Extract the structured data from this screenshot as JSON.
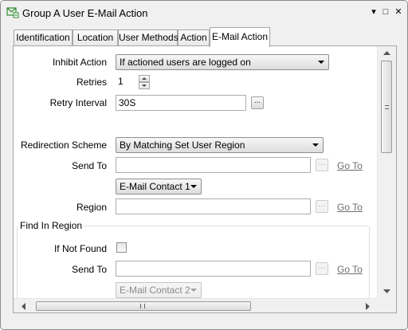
{
  "window": {
    "title": "Group A User E-Mail Action",
    "controls": [
      "▾",
      "□",
      "✕"
    ]
  },
  "tabs": [
    {
      "label": "Identification",
      "active": false
    },
    {
      "label": "Location",
      "active": false
    },
    {
      "label": "User Methods",
      "active": false
    },
    {
      "label": "Action",
      "active": false
    },
    {
      "label": "E-Mail Action",
      "active": true
    }
  ],
  "form": {
    "inhibit_action": {
      "label": "Inhibit Action",
      "value": "If actioned users are logged on"
    },
    "retries": {
      "label": "Retries",
      "value": "1"
    },
    "retry_interval": {
      "label": "Retry Interval",
      "value": "30S",
      "button": "..."
    },
    "redirection_scheme": {
      "label": "Redirection Scheme",
      "value": "By Matching Set User Region"
    },
    "send_to": {
      "label": "Send To",
      "value": "",
      "button": "...",
      "link": "Go To"
    },
    "contact": {
      "value": "E-Mail Contact 1"
    },
    "region": {
      "label": "Region",
      "value": "",
      "button": "...",
      "link": "Go To"
    }
  },
  "find_in_region": {
    "title": "Find In Region",
    "if_not_found": {
      "label": "If Not Found",
      "checked": false
    },
    "send_to": {
      "label": "Send To",
      "value": "",
      "button": "...",
      "link": "Go To"
    },
    "contact": {
      "value": "E-Mail Contact 2",
      "disabled": true
    }
  },
  "colors": {
    "window_bg": "#f0f0f0",
    "panel_bg": "#ffffff",
    "link_gray": "#6d6d6d",
    "title_icon_green": "#2f8a2f"
  },
  "icons": {
    "title": "email-action-icon"
  }
}
